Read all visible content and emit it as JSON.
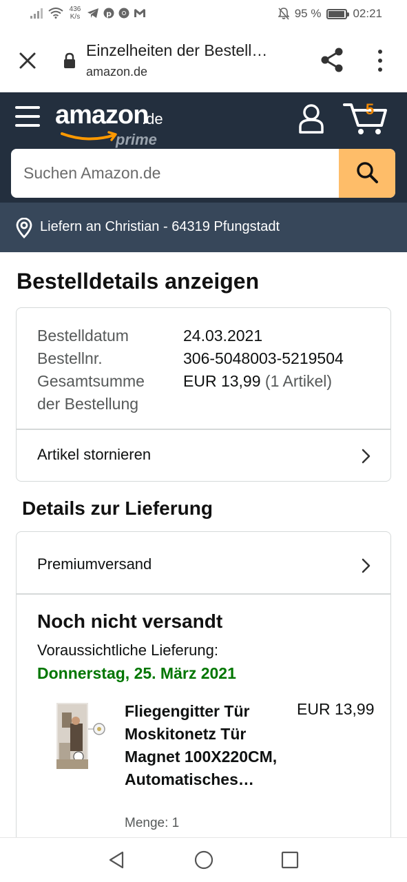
{
  "status_bar": {
    "net_speed_value": "436",
    "net_speed_unit": "K/s",
    "battery_percent": "95 %",
    "battery_level": 0.95,
    "time": "02:21",
    "icons": [
      "signal-icon",
      "wifi-icon",
      "telegram-icon",
      "pinterest-icon",
      "chrome-icon",
      "gmail-icon",
      "mute-icon",
      "battery-icon"
    ]
  },
  "browser": {
    "title": "Einzelheiten der Bestell…",
    "url": "amazon.de"
  },
  "header": {
    "logo_main": "amazon",
    "logo_tld": ".de",
    "logo_prime": "prime",
    "cart_count": "5",
    "search_placeholder": "Suchen Amazon.de",
    "accent_color": "#febd69",
    "bar_color": "#232f3e"
  },
  "delivery": {
    "text": "Liefern an Christian - 64319 Pfungstadt"
  },
  "page": {
    "title": "Bestelldetails anzeigen",
    "summary": {
      "date_label": "Bestelldatum",
      "date_value": "24.03.2021",
      "order_no_label": "Bestellnr.",
      "order_no_value": "306-5048003-5219504",
      "total_label": "Gesamtsumme der Bestellung",
      "total_value": "EUR 13,99",
      "total_items": "(1 Artikel)"
    },
    "cancel_label": "Artikel stornieren",
    "delivery_section_title": "Details zur Lieferung",
    "shipping_method": "Premiumversand",
    "ship_status": "Noch nicht versandt",
    "eta_label": "Voraussichtliche Lieferung:",
    "eta_date": "Donnerstag, 25. März 2021",
    "eta_color": "#007600",
    "product": {
      "title": "Fliegengitter Tür Moskitonetz Tür Magnet 100X220CM, Automatisches…",
      "price": "EUR 13,99",
      "quantity": "Menge: 1"
    }
  }
}
